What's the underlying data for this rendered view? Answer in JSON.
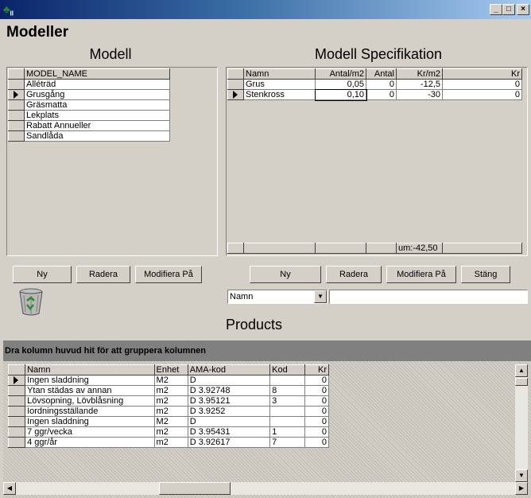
{
  "window": {
    "icon_text": "II",
    "minimize_label": "_",
    "maximize_label": "□",
    "close_label": "×"
  },
  "page_title": "Modeller",
  "modell": {
    "title": "Modell",
    "column_header": "MODEL_NAME",
    "rows": [
      "Alléträd",
      "Grusgång",
      "Gräsmatta",
      "Lekplats",
      "Rabatt Annueller",
      "Sandlåda"
    ],
    "selected_index": 1,
    "buttons": {
      "ny": "Ny",
      "radera": "Radera",
      "modifiera": "Modifiera På"
    }
  },
  "spec": {
    "title": "Modell Specifikation",
    "headers": [
      "Namn",
      "Antal/m2",
      "Antal",
      "Kr/m2",
      "Kr"
    ],
    "rows": [
      [
        "Grus",
        "0,05",
        "0",
        "-12,5",
        "0"
      ],
      [
        "Stenkross",
        "0,10",
        "0",
        "-30",
        "0"
      ]
    ],
    "selected_index": 1,
    "footer_sum": "um:-42,50",
    "buttons": {
      "ny": "Ny",
      "radera": "Radera",
      "modifiera": "Modifiera På",
      "stang": "Stäng"
    },
    "filter_field": "Namn",
    "filter_value": ""
  },
  "products": {
    "title": "Products",
    "group_hint": "Dra kolumn huvud hit för att gruppera kolumnen",
    "headers": [
      "Namn",
      "Enhet",
      "AMA-kod",
      "Kod",
      "Kr"
    ],
    "rows": [
      [
        "Ingen sladdning",
        "M2",
        "D",
        "",
        "0"
      ],
      [
        "Ytan städas av annan",
        "m2",
        "D 3.92748",
        "8",
        "0"
      ],
      [
        "Lövsopning, Lövblåsning",
        "m2",
        "D 3.95121",
        "3",
        "0"
      ],
      [
        "Iordningsställande",
        "m2",
        "D 3.9252",
        "",
        "0"
      ],
      [
        "Ingen sladdning",
        "M2",
        "D",
        "",
        "0"
      ],
      [
        "7 ggr/vecka",
        "m2",
        "D 3.95431",
        "1",
        "0"
      ],
      [
        "4 ggr/år",
        "m2",
        "D 3.92617",
        "7",
        "0"
      ]
    ],
    "selected_index": 0
  },
  "icons": {
    "recycle_bin": "recycle-bin-icon"
  }
}
